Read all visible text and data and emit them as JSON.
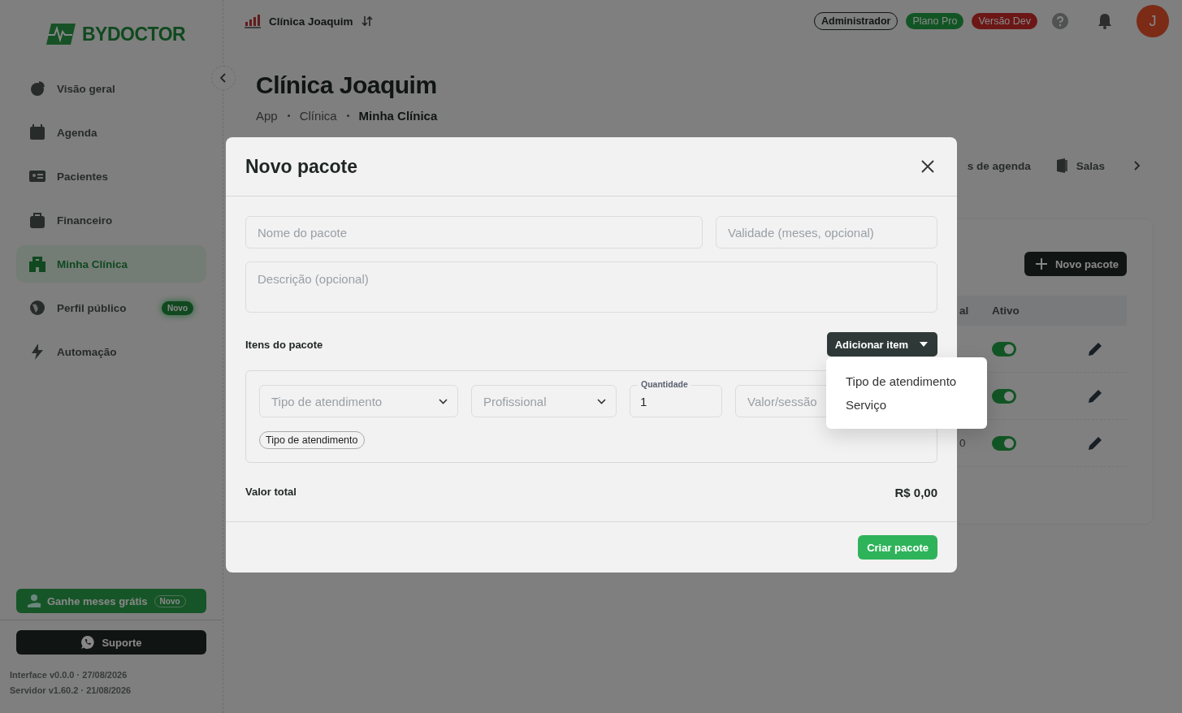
{
  "sidebar": {
    "logo": "BYDOCTOR",
    "items": [
      {
        "label": "Visão geral",
        "selected": false
      },
      {
        "label": "Agenda",
        "selected": false
      },
      {
        "label": "Pacientes",
        "selected": false
      },
      {
        "label": "Financeiro",
        "selected": false
      },
      {
        "label": "Minha Clínica",
        "selected": true
      },
      {
        "label": "Perfil público",
        "selected": false,
        "badge": "Novo"
      },
      {
        "label": "Automação",
        "selected": false
      }
    ],
    "promo": {
      "label": "Ganhe meses grátis",
      "badge": "Novo"
    },
    "support": "Suporte",
    "versions": [
      "Interface v0.0.0 · 27/08/2026",
      "Servidor v1.60.2 · 21/08/2026"
    ]
  },
  "topbar": {
    "clinic": "Clínica Joaquim",
    "badges": [
      {
        "label": "Administrador",
        "kind": "outline"
      },
      {
        "label": "Plano Pro",
        "kind": "success"
      },
      {
        "label": "Versão Dev",
        "kind": "danger"
      }
    ],
    "avatar": "J"
  },
  "page": {
    "title": "Clínica Joaquim",
    "breadcrumb": [
      "App",
      "Clínica",
      "Minha Clínica"
    ],
    "tabs": [
      {
        "label": "s de agenda"
      },
      {
        "label": "Salas"
      }
    ],
    "card": {
      "button": "Novo pacote",
      "columns": [
        "al",
        "Ativo"
      ],
      "rows": [
        {
          "on": true
        },
        {
          "on": true
        },
        {
          "total": "0",
          "on": true
        }
      ]
    }
  },
  "modal": {
    "title": "Novo pacote",
    "fields": [
      {
        "placeholder": "Nome do pacote"
      },
      {
        "placeholder": "Validade (meses, opcional)"
      }
    ],
    "description": {
      "placeholder": "Descrição (opcional)"
    },
    "items_label": "Itens do pacote",
    "add_button": "Adicionar item",
    "item": {
      "type_select": "Tipo de atendimento",
      "professional_select": "Profissional",
      "quantity": {
        "label": "Quantidade",
        "value": "1"
      },
      "price": {
        "placeholder": "Valor/sessão"
      },
      "chip": "Tipo de atendimento"
    },
    "total_label": "Valor total",
    "total": "R$ 0,00",
    "submit": "Criar pacote",
    "menu": [
      "Tipo de atendimento",
      "Serviço"
    ]
  }
}
